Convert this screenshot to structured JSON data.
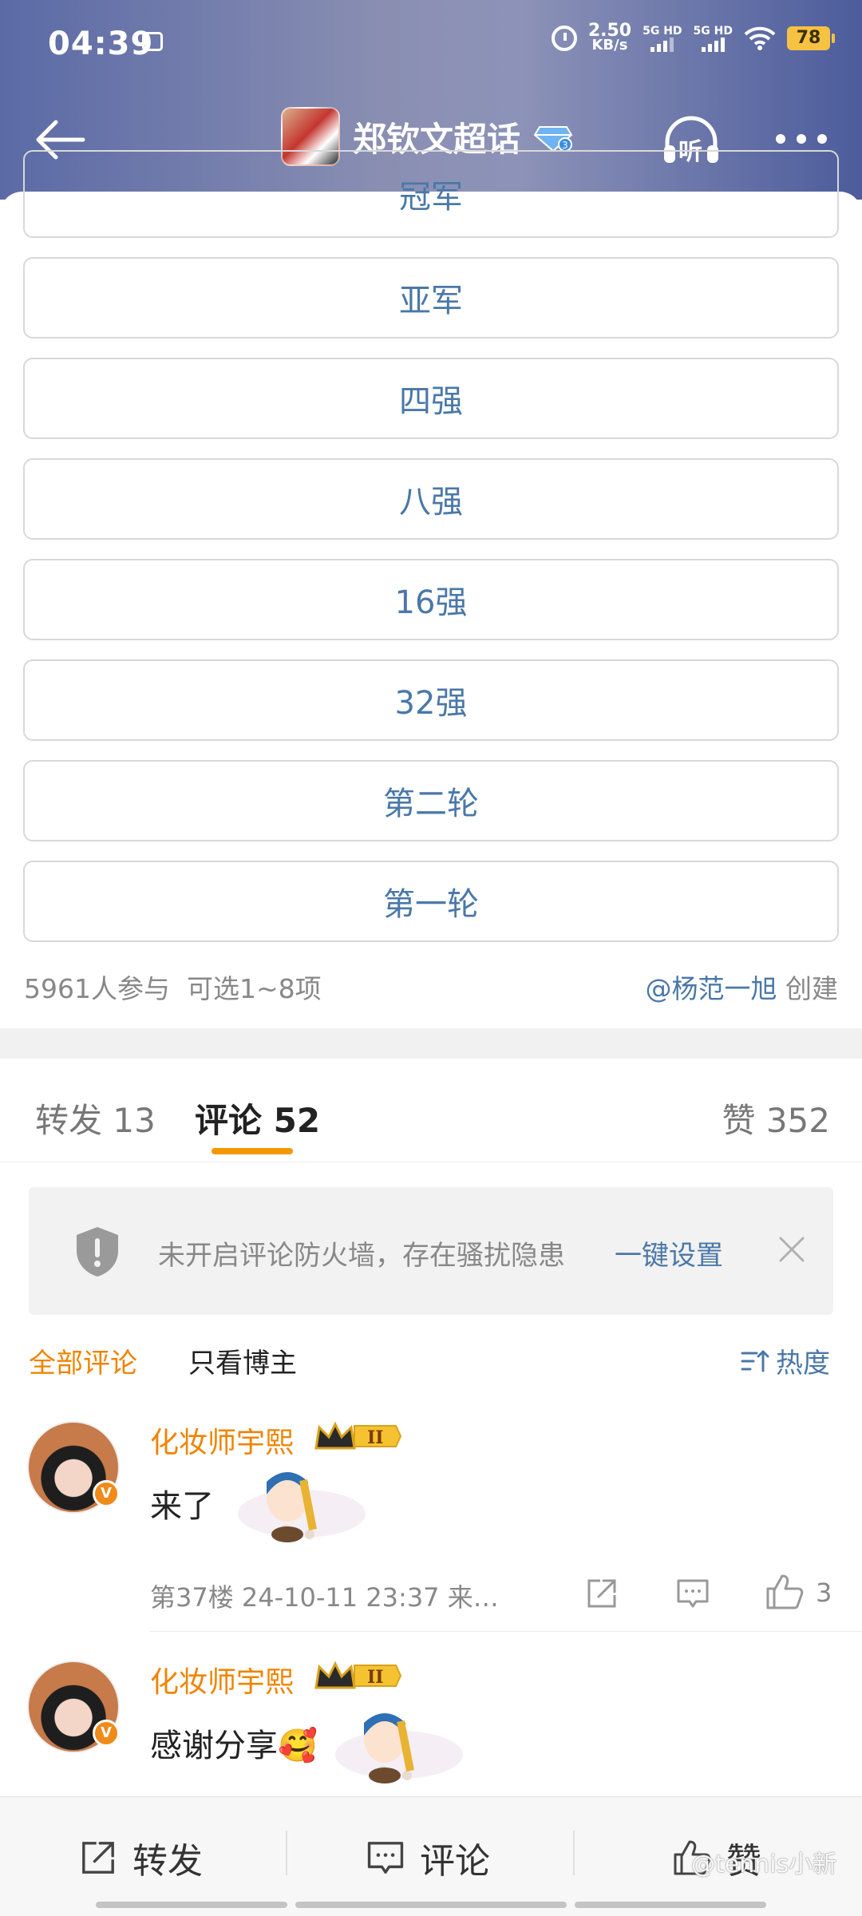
{
  "status_bar": {
    "time": "04:39",
    "net_speed_value": "2.50",
    "net_speed_unit": "KB/s",
    "sim1": "5G HD",
    "sim2": "5G HD",
    "battery": "78"
  },
  "nav": {
    "title": "郑钦文超话",
    "back_icon": "arrow-left-icon",
    "listen_label": "听",
    "more_icon": "more-dots-icon",
    "badge_icon": "diamond-level-3-icon"
  },
  "vote": {
    "options": [
      "冠军",
      "亚军",
      "四强",
      "八强",
      "16强",
      "32强",
      "第二轮",
      "第一轮"
    ],
    "participants": "5961人参与",
    "selectable": "可选1~8项",
    "creator": "@杨范一旭",
    "creator_suffix": "创建"
  },
  "tabs": {
    "repost": "转发 13",
    "comments": "评论 52",
    "likes": "赞 352"
  },
  "firewall": {
    "text": "未开启评论防火墙，存在骚扰隐患",
    "action": "一键设置"
  },
  "filters": {
    "all": "全部评论",
    "author_only": "只看博主",
    "sort": "热度"
  },
  "comments": [
    {
      "user": "化妆师宇熙",
      "level_badge": "II",
      "verified_mark": "V",
      "text": "来了",
      "meta": "第37楼  24-10-11 23:37  来…",
      "likes": "3"
    },
    {
      "user": "化妆师宇熙",
      "level_badge": "II",
      "verified_mark": "V",
      "text": "感谢分享🥰"
    }
  ],
  "bottom_bar": {
    "repost": "转发",
    "comment": "评论",
    "like": "赞"
  },
  "watermark": "@tennis小新",
  "colors": {
    "accent_orange": "#f08400",
    "link_blue": "#4a78a8",
    "header_gradient_left": "#5b6aa6",
    "header_gradient_right": "#4c5c9c"
  }
}
